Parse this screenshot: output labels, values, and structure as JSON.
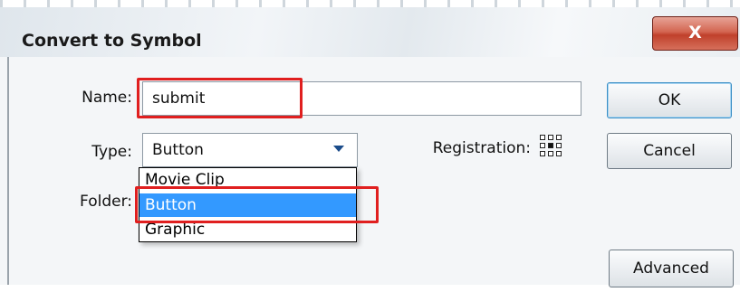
{
  "dialog": {
    "title": "Convert to Symbol",
    "close_label": "X"
  },
  "form": {
    "name_label": "Name:",
    "name_value": "submit",
    "type_label": "Type:",
    "type_selected": "Button",
    "folder_label": "Folder:",
    "registration_label": "Registration:",
    "type_options": [
      "Movie Clip",
      "Button",
      "Graphic"
    ]
  },
  "buttons": {
    "ok": "OK",
    "cancel": "Cancel",
    "advanced": "Advanced"
  },
  "colors": {
    "highlight": "#e01f1f",
    "selected_item": "#3399ff"
  }
}
